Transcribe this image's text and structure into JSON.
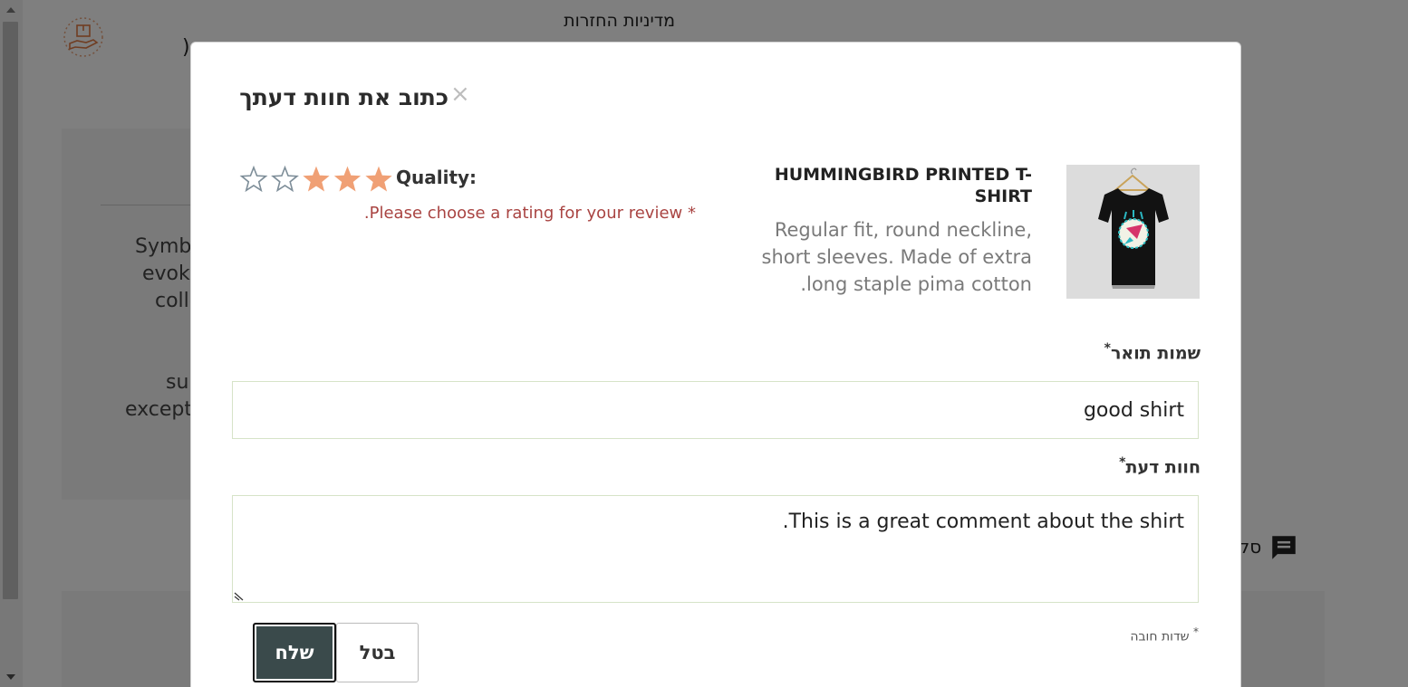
{
  "background": {
    "return_policy_title": "מדיניות החזרות",
    "paren": ")",
    "text_lines": [
      "Symb",
      "evoke",
      "colle",
      "su",
      "except"
    ],
    "chat_label": "סק"
  },
  "modal": {
    "title": "כתוב את חוות דעתך",
    "close_symbol": "×",
    "product": {
      "name": "HUMMINGBIRD PRINTED T-SHIRT",
      "description": "Regular fit, round neckline, short sleeves. Made of extra long staple pima cotton."
    },
    "rating": {
      "label": "Quality:",
      "value": 3,
      "max": 5,
      "error": "* Please choose a rating for your review."
    },
    "summary_field": {
      "label": "שמות תואר",
      "required_mark": "*",
      "value": "good shirt"
    },
    "review_field": {
      "label": "חוות דעת",
      "required_mark": "*",
      "value": "This is a great comment about the shirt."
    },
    "required_note": "שדות חובה",
    "required_note_mark": "*",
    "buttons": {
      "send": "שלח",
      "cancel": "בטל"
    }
  },
  "colors": {
    "star_filled": "#f0a075",
    "star_empty_stroke": "#7d8d98",
    "error_text": "#a94442",
    "send_button_bg": "#3a4a4b"
  }
}
